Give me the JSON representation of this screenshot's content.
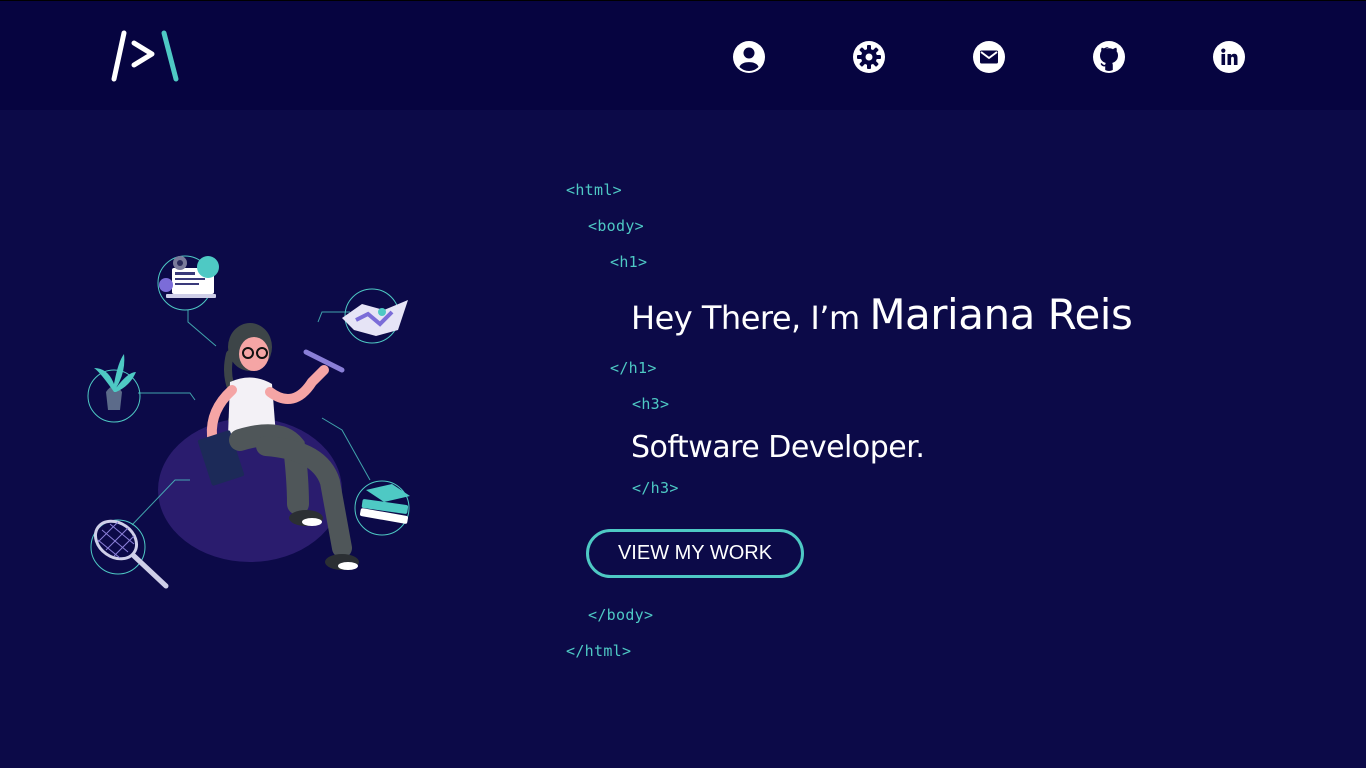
{
  "header": {
    "logo_text": "/>\\",
    "nav": [
      {
        "icon": "user-icon",
        "label": "About"
      },
      {
        "icon": "gear-icon",
        "label": "Skills"
      },
      {
        "icon": "mail-icon",
        "label": "Contact"
      },
      {
        "icon": "github-icon",
        "label": "GitHub"
      },
      {
        "icon": "linkedin-icon",
        "label": "LinkedIn"
      }
    ]
  },
  "hero": {
    "code_tags": {
      "html_open": "<html>",
      "body_open": "<body>",
      "h1_open": "<h1>",
      "h1_close": "</h1>",
      "h3_open": "<h3>",
      "h3_close": "</h3>",
      "body_close": "</body>",
      "html_close": "</html>"
    },
    "greeting": "Hey There, I’m",
    "name": "Mariana Reis",
    "role": "Software Developer.",
    "cta_label": "VIEW MY WORK"
  },
  "colors": {
    "background": "#0c0a48",
    "header_background": "#060440",
    "accent": "#4ec9c4",
    "text": "#ffffff"
  }
}
